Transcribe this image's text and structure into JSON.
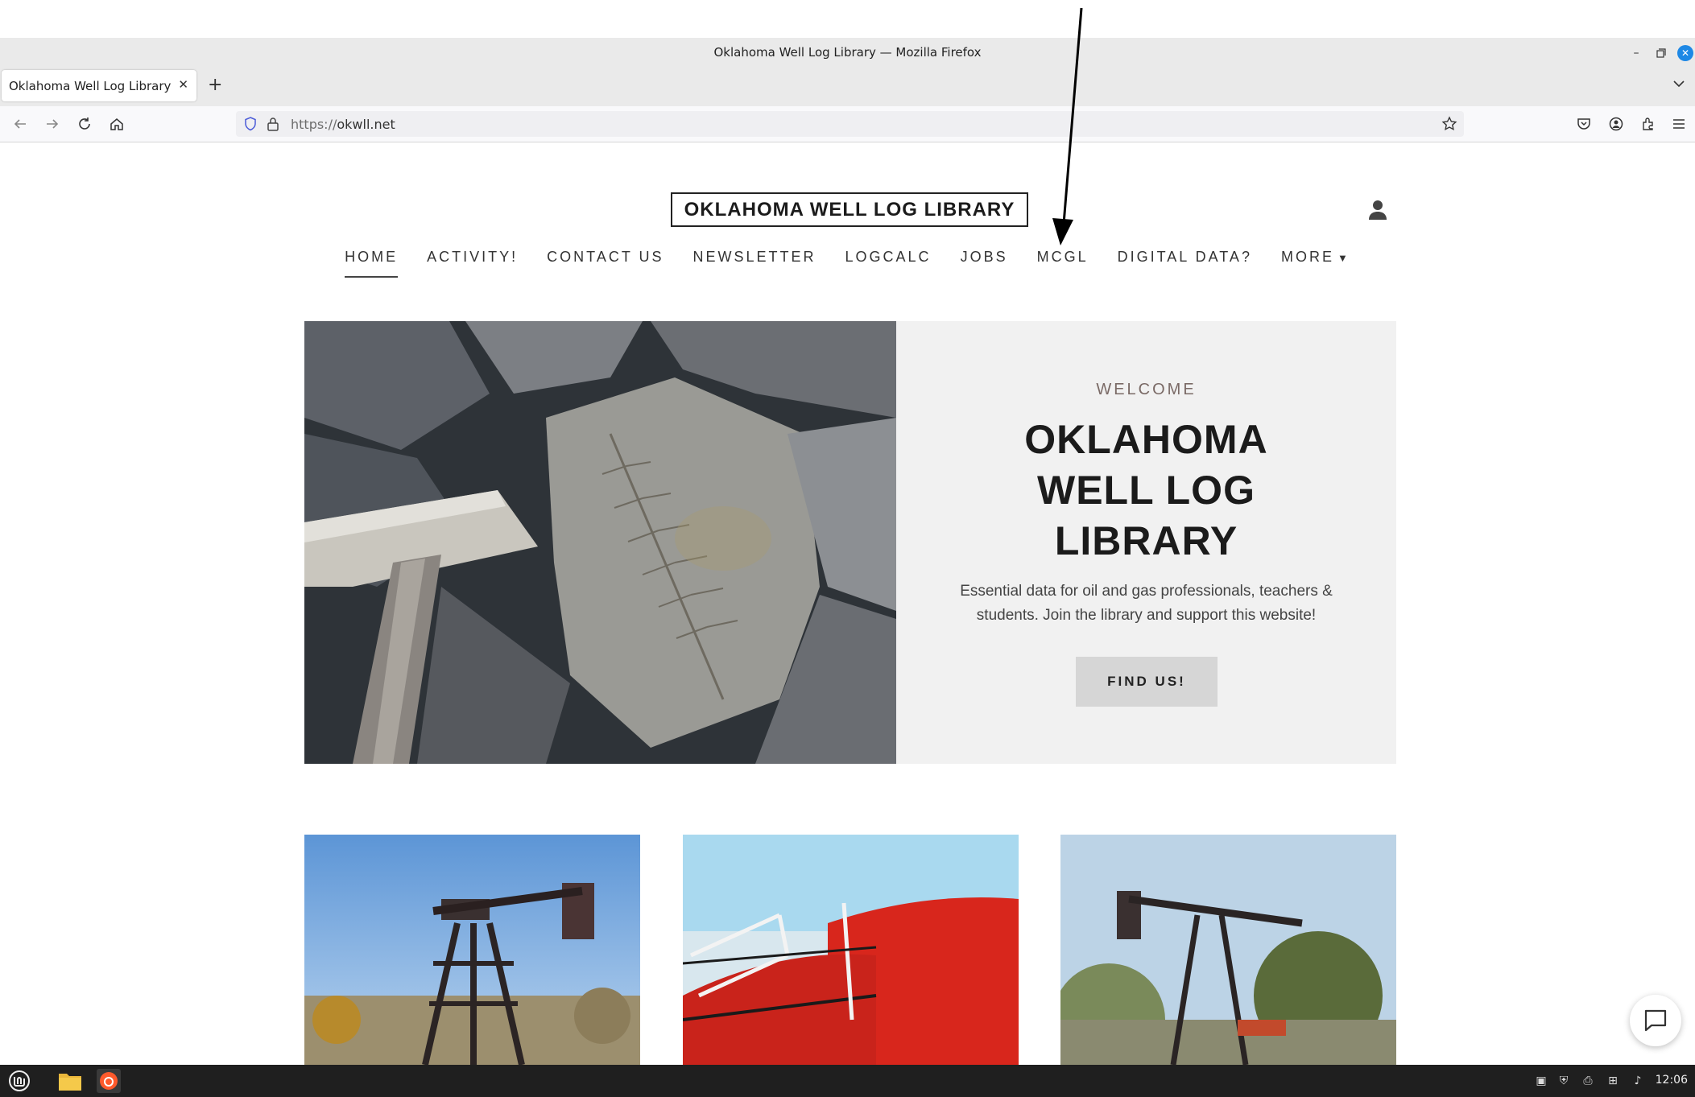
{
  "browser": {
    "window_title": "Oklahoma Well Log Library — Mozilla Firefox",
    "tab_title": "Oklahoma Well Log Library",
    "url_scheme": "https://",
    "url_host": "okwll.net"
  },
  "site": {
    "title": "OKLAHOMA WELL LOG LIBRARY",
    "nav": [
      "HOME",
      "ACTIVITY!",
      "CONTACT US",
      "NEWSLETTER",
      "LOGCALC",
      "JOBS",
      "MCGL",
      "DIGITAL DATA?",
      "MORE"
    ],
    "active_nav": "HOME"
  },
  "hero": {
    "kicker": "WELCOME",
    "heading_line1": "OKLAHOMA",
    "heading_line2": "WELL LOG",
    "heading_line3": "LIBRARY",
    "text": "Essential data for oil and gas professionals, teachers & students. Join the library and support this website!",
    "button": "FIND US!"
  },
  "taskbar": {
    "clock": "12:06"
  },
  "icons": {
    "back": "back-arrow-icon",
    "forward": "forward-arrow-icon",
    "reload": "reload-icon",
    "home": "home-icon",
    "bookmark": "star-icon",
    "account": "user-icon",
    "chat": "chat-bubble-icon"
  },
  "colors": {
    "hero_panel": "#f1f1f1",
    "button": "#d6d6d6",
    "taskbar": "#1f1f1f",
    "firefox_close": "#1e88e5"
  }
}
